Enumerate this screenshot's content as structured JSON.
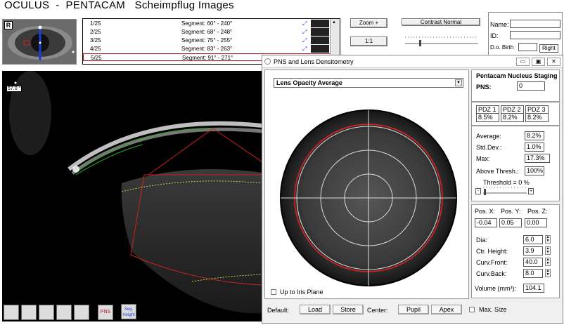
{
  "header": {
    "title": "OCULUS  -  PENTACAM   Scheimpflug Images"
  },
  "thumbnail": {
    "eye_label": "R"
  },
  "segments": [
    {
      "idx": "1/25",
      "label": "Segment: 60° - 240°"
    },
    {
      "idx": "2/25",
      "label": "Segment: 68° - 248°"
    },
    {
      "idx": "3/25",
      "label": "Segment: 75° - 255°"
    },
    {
      "idx": "4/25",
      "label": "Segment: 83° - 263°"
    },
    {
      "idx": "5/25",
      "label": "Segment: 91° - 271°"
    }
  ],
  "controls": {
    "zoom_label": "Zoom +",
    "ratio_label": "1:1",
    "contrast_label": "Contrast Normal"
  },
  "patient": {
    "name_label": "Name:",
    "id_label": "ID:",
    "dob_label": "D.o. Birth",
    "eye_value": "Right"
  },
  "image": {
    "angle_label": "57.0 °"
  },
  "dialog": {
    "title": "PNS and Lens Densitometry",
    "mode": "Lens Opacity Average",
    "up_to_iris_label": "Up to Iris Plane",
    "staging_title": "Pentacam Nucleus Staging",
    "pns_label": "PNS:",
    "pns_value": "0",
    "pdz": [
      {
        "label": "PDZ 1",
        "value": "8.5%"
      },
      {
        "label": "PDZ 2",
        "value": "8.2%"
      },
      {
        "label": "PDZ 3",
        "value": "8.2%"
      }
    ],
    "stats": {
      "average_label": "Average:",
      "average_value": "8.2%",
      "std_label": "Std.Dev.:",
      "std_value": "1.0%",
      "max_label": "Max:",
      "max_value": "17.3%",
      "above_label": "Above Thresh.:",
      "above_value": "100%",
      "threshold_label": "Threshold = 0 %"
    },
    "position": {
      "x_label": "Pos. X:",
      "y_label": "Pos. Y:",
      "z_label": "Pos. Z:",
      "x_value": "-0.04",
      "y_value": "0.05",
      "z_value": "0.00"
    },
    "geometry": {
      "dia_label": "Dia:",
      "dia_value": "6.0",
      "ctr_label": "Ctr. Height:",
      "ctr_value": "3.9",
      "front_label": "Curv.Front:",
      "front_value": "40.0",
      "back_label": "Curv.Back:",
      "back_value": "8.0",
      "volume_label": "Volume (mm³):",
      "volume_value": "104.1"
    },
    "footer": {
      "default_label": "Default:",
      "load_label": "Load",
      "store_label": "Store",
      "center_label": "Center:",
      "pupil_label": "Pupil",
      "apex_label": "Apex",
      "maxsize_label": "Max. Size"
    }
  },
  "toolbar": {
    "pns_label": "PNS",
    "seg_label": "Seg. Height"
  },
  "colors": {
    "selection": "#b01010",
    "lens_outline": "#e02020",
    "accent_blue": "#1a3fd6"
  }
}
